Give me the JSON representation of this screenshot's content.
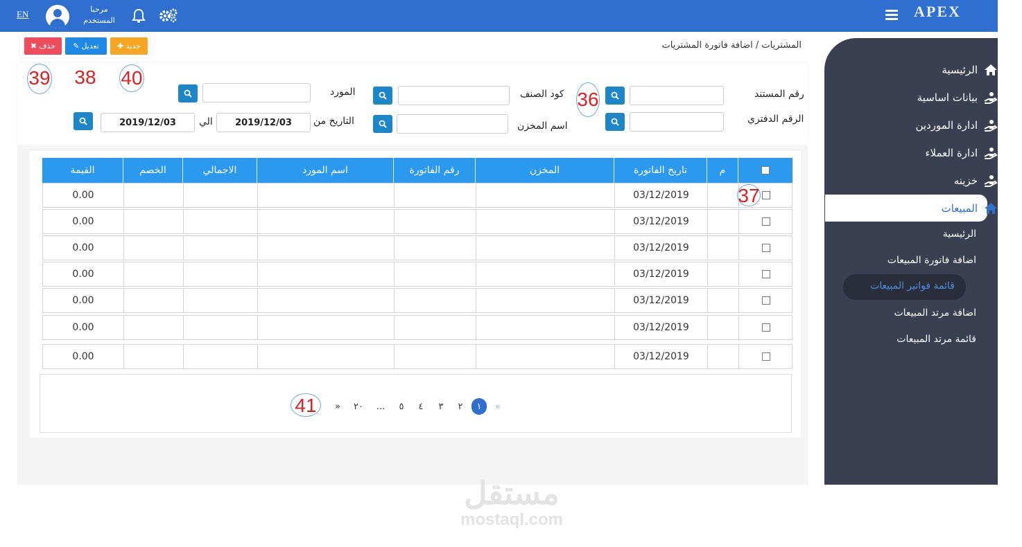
{
  "header": {
    "lang": "EN",
    "welcome_line1": "مرحبا",
    "welcome_line2": "المستخدم",
    "logo": "APEX"
  },
  "breadcrumb": "المشتريات / اضافة فاتورة المشتريات",
  "toolbar": {
    "delete": "حذف",
    "edit": "تعديل",
    "new": "جديد"
  },
  "sidebar": {
    "items": [
      "الرئيسية",
      "بيانات اساسية",
      "ادارة الموردين",
      "ادارة العملاء",
      "خزينه",
      "المبيعات"
    ],
    "sub_items": [
      "الرئيسية",
      "اضافة فاتورة المبيعات",
      "قائمة فواتير المبيعات",
      "اضافة مرتد المبيعات",
      "قائمة مرتد المبيعات"
    ]
  },
  "filters": {
    "doc_no": "رقم المستند",
    "item_code": "كود الصنف",
    "supplier": "المورد",
    "ledger_no": "الرقم الدفتري",
    "store_name": "اسم المخزن",
    "date_from_label": "التاريخ من",
    "date_to_label": "الي",
    "date_from": "2019/12/03",
    "date_to": "2019/12/03"
  },
  "table": {
    "headers": [
      "م",
      "تاريخ الفاتورة",
      "المخزن",
      "رقم الفاتورة",
      "اسم المورد",
      "الاجمالي",
      "الخصم",
      "القيمة"
    ],
    "rows": [
      {
        "date": "03/12/2019",
        "value": "0.00"
      },
      {
        "date": "03/12/2019",
        "value": "0.00"
      },
      {
        "date": "03/12/2019",
        "value": "0.00"
      },
      {
        "date": "03/12/2019",
        "value": "0.00"
      },
      {
        "date": "03/12/2019",
        "value": "0.00"
      },
      {
        "date": "03/12/2019",
        "value": "0.00"
      },
      {
        "date": "03/12/2019",
        "value": "0.00"
      }
    ]
  },
  "pagination": {
    "prev": "«",
    "pages": [
      "١",
      "٢",
      "٣",
      "٤",
      "٥",
      "...",
      "٢٠"
    ],
    "next": "»"
  },
  "annotations": {
    "a36": "36",
    "a37": "37",
    "a38": "38",
    "a39": "39",
    "a40": "40",
    "a41": "41"
  },
  "watermark": {
    "line1": "مستقل",
    "line2": "mostaql.com"
  },
  "colors": {
    "primary": "#2f6fcf",
    "sidebar": "#3a3f51",
    "table_header": "#2b99ee",
    "search_button": "#1c86c8",
    "delete": "#ef4d5d",
    "edit": "#1e88e5",
    "new": "#f5a623"
  }
}
